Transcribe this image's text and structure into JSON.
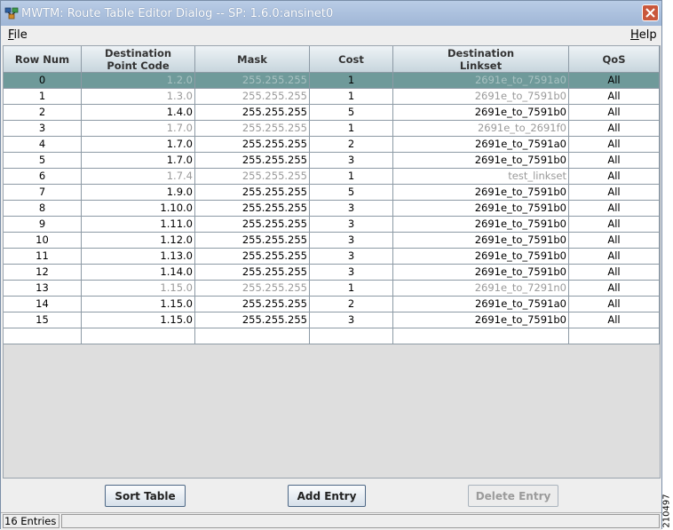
{
  "window": {
    "title": "MWTM: Route Table Editor Dialog -- SP: 1.6.0:ansinet0"
  },
  "menu": {
    "file": {
      "mnemonic": "F",
      "rest": "ile"
    },
    "help": {
      "mnemonic": "H",
      "rest": "elp"
    }
  },
  "table": {
    "headers": {
      "row_num": "Row Num",
      "dpc_line1": "Destination",
      "dpc_line2": "Point Code",
      "mask": "Mask",
      "cost": "Cost",
      "linkset_line1": "Destination",
      "linkset_line2": "Linkset",
      "qos": "QoS"
    },
    "rows": [
      {
        "num": "0",
        "dpc": "1.2.0",
        "mask": "255.255.255",
        "cost": "1",
        "linkset": "2691e_to_7591a0",
        "qos": "All"
      },
      {
        "num": "1",
        "dpc": "1.3.0",
        "mask": "255.255.255",
        "cost": "1",
        "linkset": "2691e_to_7591b0",
        "qos": "All"
      },
      {
        "num": "2",
        "dpc": "1.4.0",
        "mask": "255.255.255",
        "cost": "5",
        "linkset": "2691e_to_7591b0",
        "qos": "All"
      },
      {
        "num": "3",
        "dpc": "1.7.0",
        "mask": "255.255.255",
        "cost": "1",
        "linkset": "2691e_to_2691f0",
        "qos": "All"
      },
      {
        "num": "4",
        "dpc": "1.7.0",
        "mask": "255.255.255",
        "cost": "2",
        "linkset": "2691e_to_7591a0",
        "qos": "All"
      },
      {
        "num": "5",
        "dpc": "1.7.0",
        "mask": "255.255.255",
        "cost": "3",
        "linkset": "2691e_to_7591b0",
        "qos": "All"
      },
      {
        "num": "6",
        "dpc": "1.7.4",
        "mask": "255.255.255",
        "cost": "1",
        "linkset": "test_linkset",
        "qos": "All"
      },
      {
        "num": "7",
        "dpc": "1.9.0",
        "mask": "255.255.255",
        "cost": "5",
        "linkset": "2691e_to_7591b0",
        "qos": "All"
      },
      {
        "num": "8",
        "dpc": "1.10.0",
        "mask": "255.255.255",
        "cost": "3",
        "linkset": "2691e_to_7591b0",
        "qos": "All"
      },
      {
        "num": "9",
        "dpc": "1.11.0",
        "mask": "255.255.255",
        "cost": "3",
        "linkset": "2691e_to_7591b0",
        "qos": "All"
      },
      {
        "num": "10",
        "dpc": "1.12.0",
        "mask": "255.255.255",
        "cost": "3",
        "linkset": "2691e_to_7591b0",
        "qos": "All"
      },
      {
        "num": "11",
        "dpc": "1.13.0",
        "mask": "255.255.255",
        "cost": "3",
        "linkset": "2691e_to_7591b0",
        "qos": "All"
      },
      {
        "num": "12",
        "dpc": "1.14.0",
        "mask": "255.255.255",
        "cost": "3",
        "linkset": "2691e_to_7591b0",
        "qos": "All"
      },
      {
        "num": "13",
        "dpc": "1.15.0",
        "mask": "255.255.255",
        "cost": "1",
        "linkset": "2691e_to_7291n0",
        "qos": "All"
      },
      {
        "num": "14",
        "dpc": "1.15.0",
        "mask": "255.255.255",
        "cost": "2",
        "linkset": "2691e_to_7591a0",
        "qos": "All"
      },
      {
        "num": "15",
        "dpc": "1.15.0",
        "mask": "255.255.255",
        "cost": "3",
        "linkset": "2691e_to_7591b0",
        "qos": "All"
      },
      {
        "num": "",
        "dpc": "",
        "mask": "",
        "cost": "",
        "linkset": "",
        "qos": ""
      }
    ]
  },
  "buttons": {
    "sort": "Sort Table",
    "add": "Add Entry",
    "delete": "Delete Entry"
  },
  "status": {
    "entries": "16 Entries"
  },
  "figure_id": "210497",
  "colors": {
    "selected_row": "#6f9a9a",
    "dimmed_text": "#9a9a9a",
    "title_bar": "#a9bfdd",
    "close_button": "#c9573c"
  }
}
